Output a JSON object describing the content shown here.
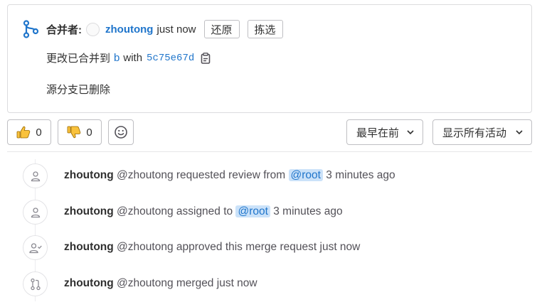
{
  "merge": {
    "label": "合并者:",
    "user": "zhoutong",
    "time": "just now",
    "revert_label": "还原",
    "cherry_pick_label": "拣选",
    "line2_prefix": "更改已合并到",
    "target_branch": "b",
    "with_text": "with",
    "commit_sha": "5c75e67d",
    "line3": "源分支已删除"
  },
  "toolbar": {
    "thumbs_up_count": "0",
    "thumbs_down_count": "0",
    "sort_label": "最早在前",
    "filter_label": "显示所有活动"
  },
  "events": [
    {
      "icon": "user-icon",
      "name": "zhoutong",
      "handle": "@zhoutong",
      "action": "requested review from",
      "mention": "@root",
      "time": "3 minutes ago"
    },
    {
      "icon": "user-icon",
      "name": "zhoutong",
      "handle": "@zhoutong",
      "action": "assigned to",
      "mention": "@root",
      "time": "3 minutes ago"
    },
    {
      "icon": "approval-icon",
      "name": "zhoutong",
      "handle": "@zhoutong",
      "action": "approved this merge request",
      "mention": "",
      "time": "just now"
    },
    {
      "icon": "git-merge-icon",
      "name": "zhoutong",
      "handle": "@zhoutong",
      "action": "merged",
      "mention": "",
      "time": "just now"
    }
  ],
  "colors": {
    "link": "#1f75cb",
    "mention_bg": "#cbe2f9",
    "text": "#303030"
  }
}
